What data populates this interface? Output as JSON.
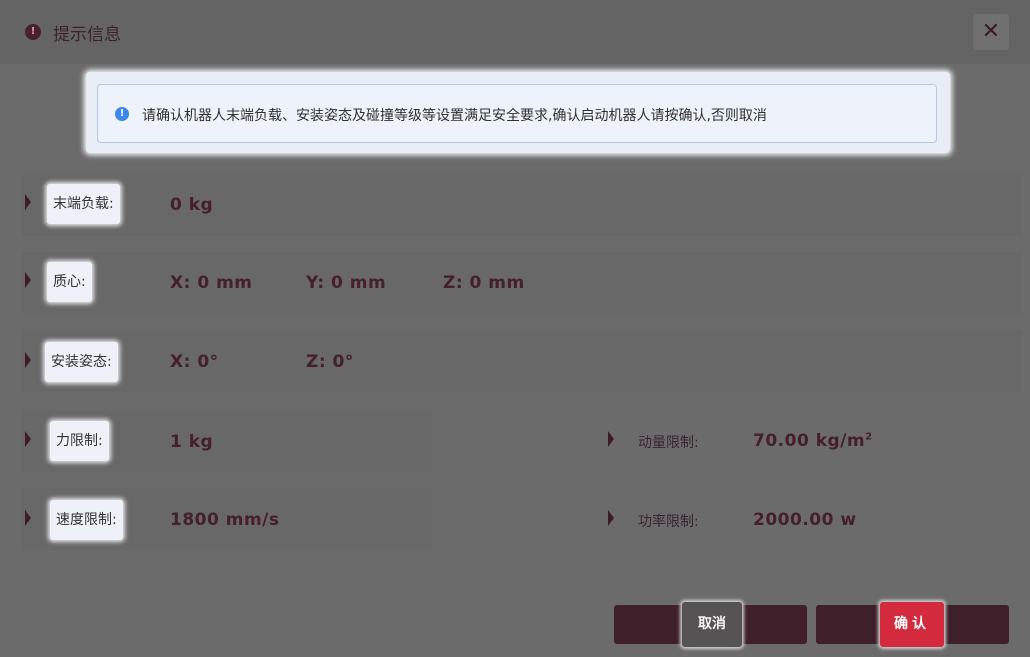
{
  "dialog": {
    "title": "提示信息",
    "title_icon": "info-circle-icon",
    "close_glyph": "✕"
  },
  "notice": {
    "icon": "info-icon",
    "text": "请确认机器人末端负载、安装姿态及碰撞等级等设置满足安全要求,确认启动机器人请按确认,否则取消"
  },
  "rows": {
    "payload": {
      "label": "末端负载:",
      "value": "0 kg"
    },
    "center_of_mass": {
      "label": "质心:",
      "x": "X: 0 mm",
      "y": "Y: 0 mm",
      "z": "Z: 0 mm"
    },
    "mount_pose": {
      "label": "安装姿态:",
      "x": "X: 0°",
      "z": "Z: 0°"
    },
    "force_limit": {
      "label": "力限制:",
      "value": "1 kg"
    },
    "momentum_limit": {
      "label": "动量限制:",
      "value": "70.00 kg/m",
      "unit_sup": "2"
    },
    "speed_limit": {
      "label": "速度限制:",
      "value": "1800 mm/s"
    },
    "power_limit": {
      "label": "功率限制:",
      "value": "2000.00 w"
    }
  },
  "buttons": {
    "cancel": "取消",
    "confirm": "确认"
  },
  "colors": {
    "accent": "#d42a3e",
    "dark": "#3f1f2a",
    "info": "#3a87f0"
  }
}
